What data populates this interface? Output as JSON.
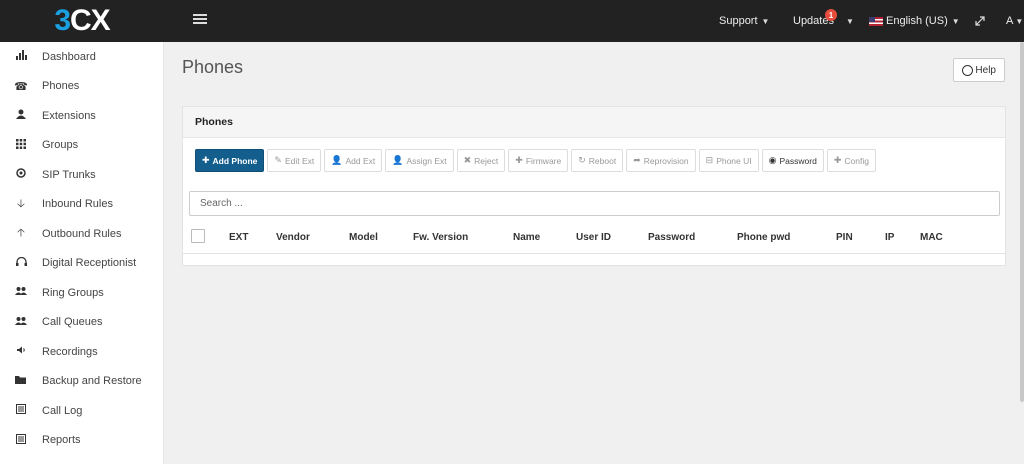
{
  "topbar": {
    "logo": "3CX",
    "support": "Support",
    "updates": "Updates",
    "updates_badge": "1",
    "language": "English (US)",
    "user": "A"
  },
  "sidebar": {
    "items": [
      {
        "label": "Dashboard",
        "icon": "bar-chart-icon"
      },
      {
        "label": "Phones",
        "icon": "phone-icon"
      },
      {
        "label": "Extensions",
        "icon": "user-icon"
      },
      {
        "label": "Groups",
        "icon": "grid-icon"
      },
      {
        "label": "SIP Trunks",
        "icon": "globe-icon"
      },
      {
        "label": "Inbound Rules",
        "icon": "arrow-down-icon"
      },
      {
        "label": "Outbound Rules",
        "icon": "arrow-up-icon"
      },
      {
        "label": "Digital Receptionist",
        "icon": "headset-icon"
      },
      {
        "label": "Ring Groups",
        "icon": "users-icon"
      },
      {
        "label": "Call Queues",
        "icon": "users-icon"
      },
      {
        "label": "Recordings",
        "icon": "volume-icon"
      },
      {
        "label": "Backup and Restore",
        "icon": "folder-icon"
      },
      {
        "label": "Call Log",
        "icon": "list-icon"
      },
      {
        "label": "Reports",
        "icon": "list-icon"
      }
    ]
  },
  "main": {
    "title": "Phones",
    "help_label": "Help",
    "panel_title": "Phones",
    "toolbar": {
      "add_phone": "Add Phone",
      "edit_ext": "Edit Ext",
      "add_ext": "Add Ext",
      "assign_ext": "Assign Ext",
      "reject": "Reject",
      "firmware": "Firmware",
      "reboot": "Reboot",
      "reprovision": "Reprovision",
      "phone_ui": "Phone UI",
      "password": "Password",
      "config": "Config"
    },
    "search_placeholder": "Search ...",
    "columns": [
      "EXT",
      "Vendor",
      "Model",
      "Fw. Version",
      "Name",
      "User ID",
      "Password",
      "Phone pwd",
      "PIN",
      "IP",
      "MAC"
    ]
  },
  "colors": {
    "topbar_bg": "#222222",
    "primary_button": "#135e8c",
    "badge": "#e74c3c"
  }
}
